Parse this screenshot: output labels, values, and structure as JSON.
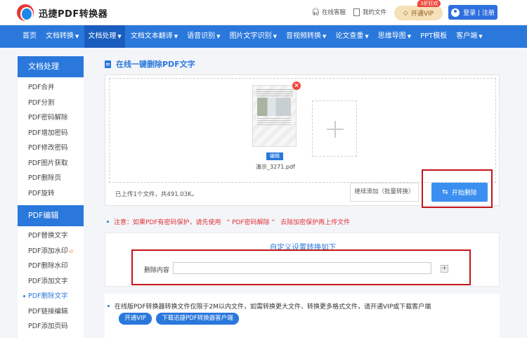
{
  "header": {
    "logo_text": "迅捷PDF转换器",
    "support_label": "在线客服",
    "my_files_label": "我的文件",
    "vip_label": "开通VIP",
    "vip_badge": "3折狂欢",
    "login_label": "登录 | 注册"
  },
  "nav": {
    "items": [
      "首页",
      "文档转换",
      "文档处理",
      "文档文本翻译",
      "语音识别",
      "图片文字识别",
      "音视频转换",
      "论文查重",
      "思维导图",
      "PPT模板",
      "客户端"
    ],
    "active": "文档处理"
  },
  "sidebar": {
    "section1_title": "文档处理",
    "section1_items": [
      "PDF合并",
      "PDF分割",
      "PDF密码解除",
      "PDF增加密码",
      "PDF修改密码",
      "PDF图片获取",
      "PDF删除页",
      "PDF旋转"
    ],
    "section2_title": "PDF编辑",
    "section2_items": [
      "PDF替换文字",
      "PDF添加水印",
      "PDF删除水印",
      "PDF添加文字",
      "PDF删除文字",
      "PDF链接编辑",
      "PDF添加页码"
    ],
    "active_item": "PDF删除文字"
  },
  "main": {
    "title": "在线一键删除PDF文字",
    "file_name": "演示_3271.pdf",
    "edit_label": "编辑",
    "upload_info": "已上传1个文件，共491.03K。",
    "continue_label": "继续添加（批量转换）",
    "start_label": "开始删除",
    "notice_prefix": "注意：如果PDF有密码保护，请先使用",
    "notice_link": "“ PDF密码解除 ”",
    "notice_suffix": "去除加密保护再上传文件",
    "settings_title": "自定义设置转换如下",
    "field_label": "删除内容",
    "field_value": "",
    "promo_text": "在线版PDF转换器转换文件仅限于2M以内文件，如需转换更大文件、转换更多格式文件，请开通VIP或下载客户端",
    "promo_vip_label": "开通VIP",
    "promo_download_label": "下载迅捷PDF转换器客户端"
  },
  "icons": {
    "support": "headset-icon",
    "files": "file-icon",
    "vip": "diamond-icon",
    "user": "user-icon",
    "doc": "document-icon",
    "swap": "swap-icon",
    "fire": "fire-icon"
  },
  "colors": {
    "primary": "#2a78dc",
    "nav_active": "#1a5dbf",
    "highlight": "#c4161c",
    "warning_text": "#e0333a",
    "vip_bg": "#f6e0b8"
  }
}
